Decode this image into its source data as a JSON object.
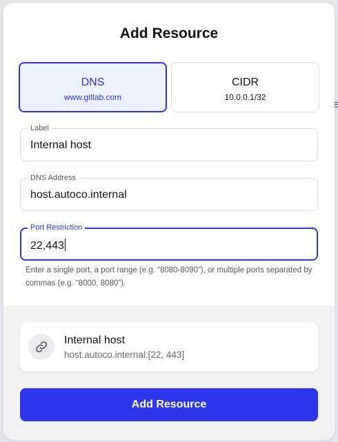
{
  "backdrop": {
    "peek_text": "e"
  },
  "dialog": {
    "title": "Add Resource",
    "type_selector": [
      {
        "label": "DNS",
        "example": "www.gitlab.com",
        "selected": true
      },
      {
        "label": "CIDR",
        "example": "10.0.0.1/32",
        "selected": false
      }
    ],
    "fields": {
      "label": {
        "label": "Label",
        "value": "Internal host"
      },
      "dns_address": {
        "label": "DNS Address",
        "value": "host.autoco.internal"
      },
      "port_restriction": {
        "label": "Port Restriction",
        "value": "22,443",
        "focused": true
      }
    },
    "port_helper": "Enter a single port, a port range (e.g. “8080-8090”), or multiple ports separated by commas (e.g. “8000, 8080”).",
    "preview": {
      "icon": "link-icon",
      "name": "Internal host",
      "address": "host.autoco.internal:[22, 443]"
    },
    "submit_label": "Add Resource"
  },
  "colors": {
    "accent": "#2b35ea",
    "selected_bg": "#eef0fc",
    "footer_bg": "#f1f1f2",
    "backdrop": "#e7e7ea"
  }
}
